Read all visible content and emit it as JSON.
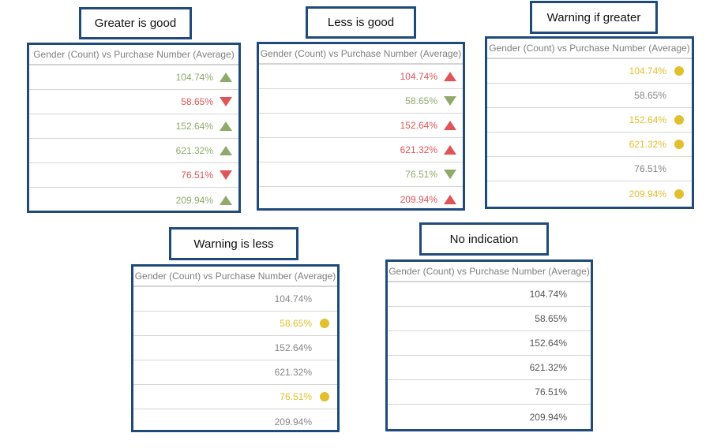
{
  "colors": {
    "border": "#1f4a7c",
    "good": "#8faa6b",
    "bad": "#e05558",
    "warning": "#e2bf2d",
    "neutral": "#858585"
  },
  "panels": [
    {
      "id": "greater-is-good",
      "label": "Greater is good",
      "header": "Gender (Count) vs Purchase Number (Average)",
      "rows": [
        {
          "value": "104.74%",
          "status": "good",
          "indicator": "triangle-up-icon"
        },
        {
          "value": "58.65%",
          "status": "bad",
          "indicator": "triangle-down-icon"
        },
        {
          "value": "152.64%",
          "status": "good",
          "indicator": "triangle-up-icon"
        },
        {
          "value": "621.32%",
          "status": "good",
          "indicator": "triangle-up-icon"
        },
        {
          "value": "76.51%",
          "status": "bad",
          "indicator": "triangle-down-icon"
        },
        {
          "value": "209.94%",
          "status": "good",
          "indicator": "triangle-up-icon"
        }
      ]
    },
    {
      "id": "less-is-good",
      "label": "Less is good",
      "header": "Gender (Count) vs Purchase Number (Average)",
      "rows": [
        {
          "value": "104.74%",
          "status": "bad",
          "indicator": "triangle-up-icon"
        },
        {
          "value": "58.65%",
          "status": "good",
          "indicator": "triangle-down-icon"
        },
        {
          "value": "152.64%",
          "status": "bad",
          "indicator": "triangle-up-icon"
        },
        {
          "value": "621.32%",
          "status": "bad",
          "indicator": "triangle-up-icon"
        },
        {
          "value": "76.51%",
          "status": "good",
          "indicator": "triangle-down-icon"
        },
        {
          "value": "209.94%",
          "status": "bad",
          "indicator": "triangle-up-icon"
        }
      ]
    },
    {
      "id": "warning-if-greater",
      "label": "Warning if greater",
      "header": "Gender (Count) vs Purchase Number (Average)",
      "rows": [
        {
          "value": "104.74%",
          "status": "warn",
          "indicator": "warning-dot-icon"
        },
        {
          "value": "58.65%",
          "status": "neutral",
          "indicator": ""
        },
        {
          "value": "152.64%",
          "status": "warn",
          "indicator": "warning-dot-icon"
        },
        {
          "value": "621.32%",
          "status": "warn",
          "indicator": "warning-dot-icon"
        },
        {
          "value": "76.51%",
          "status": "neutral",
          "indicator": ""
        },
        {
          "value": "209.94%",
          "status": "warn",
          "indicator": "warning-dot-icon"
        }
      ]
    },
    {
      "id": "warning-is-less",
      "label": "Warning is less",
      "header": "Gender (Count) vs Purchase Number (Average)",
      "rows": [
        {
          "value": "104.74%",
          "status": "neutral",
          "indicator": ""
        },
        {
          "value": "58.65%",
          "status": "warn",
          "indicator": "warning-dot-icon"
        },
        {
          "value": "152.64%",
          "status": "neutral",
          "indicator": ""
        },
        {
          "value": "621.32%",
          "status": "neutral",
          "indicator": ""
        },
        {
          "value": "76.51%",
          "status": "warn",
          "indicator": "warning-dot-icon"
        },
        {
          "value": "209.94%",
          "status": "neutral",
          "indicator": ""
        }
      ]
    },
    {
      "id": "no-indication",
      "label": "No indication",
      "header": "Gender (Count) vs Purchase Number (Average)",
      "rows": [
        {
          "value": "104.74%",
          "status": "plain",
          "indicator": ""
        },
        {
          "value": "58.65%",
          "status": "plain",
          "indicator": ""
        },
        {
          "value": "152.64%",
          "status": "plain",
          "indicator": ""
        },
        {
          "value": "621.32%",
          "status": "plain",
          "indicator": ""
        },
        {
          "value": "76.51%",
          "status": "plain",
          "indicator": ""
        },
        {
          "value": "209.94%",
          "status": "plain",
          "indicator": ""
        }
      ]
    }
  ]
}
